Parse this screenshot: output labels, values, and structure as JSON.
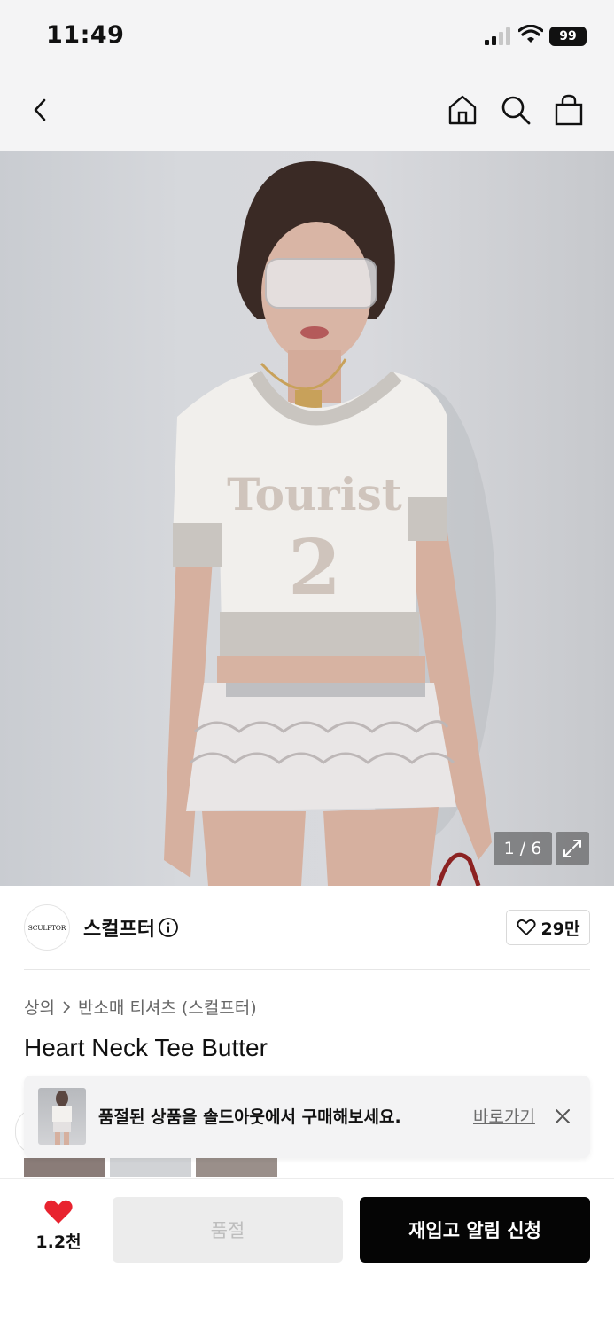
{
  "status_bar": {
    "time": "11:49",
    "battery": "99"
  },
  "nav": {
    "back_icon": "chevron-left-icon",
    "home_icon": "home-icon",
    "search_icon": "search-icon",
    "bag_icon": "shopping-bag-icon"
  },
  "gallery": {
    "counter": "1 / 6",
    "expand_icon": "expand-icon"
  },
  "brand": {
    "logo_text": "SCULPTOR",
    "name": "스컬프터",
    "info_icon": "info-icon",
    "likes": "29만"
  },
  "breadcrumb": {
    "category": "상의",
    "separator_icon": "chevron-right-icon",
    "subcategory": "반소매 티셔츠 (스컬프터)"
  },
  "product": {
    "title": "Heart Neck Tee Butter"
  },
  "banner": {
    "message": "품절된 상품을 솔드아웃에서 구매해보세요.",
    "link": "바로가기",
    "close_icon": "close-icon"
  },
  "bottom_bar": {
    "heart_count": "1.2천",
    "soldout_label": "품절",
    "restock_label": "재입고 알림 신청"
  },
  "colors": {
    "accent_red": "#e8232f",
    "primary_black": "#050505",
    "disabled_bg": "#ececec"
  }
}
